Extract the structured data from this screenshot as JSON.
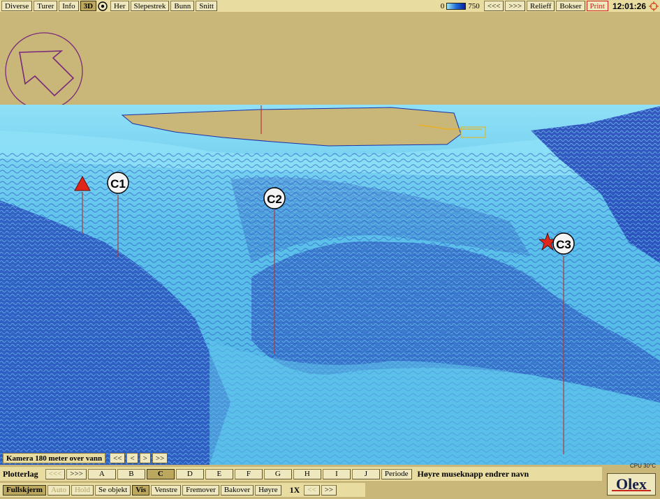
{
  "top_bar": {
    "buttons": [
      {
        "label": "Diverse"
      },
      {
        "label": "Turer"
      },
      {
        "label": "Info"
      },
      {
        "label": "3D",
        "active": true
      }
    ],
    "buttons_after_icon": [
      {
        "label": "Her"
      },
      {
        "label": "Slepestrek"
      },
      {
        "label": "Bunn"
      },
      {
        "label": "Snitt"
      }
    ],
    "depth_min": "0",
    "depth_max": "750",
    "right_buttons": [
      {
        "label": "<<<"
      },
      {
        "label": ">>>"
      },
      {
        "label": "Relieff"
      },
      {
        "label": "Bokser"
      },
      {
        "label": "Print"
      }
    ],
    "clock": "12:01:26"
  },
  "scene": {
    "markers": [
      {
        "label": "C1"
      },
      {
        "label": "C2"
      },
      {
        "label": "C3"
      }
    ],
    "symbols": [
      "triangle-marker-icon",
      "star-marker-icon",
      "compass-arrow-icon"
    ],
    "colors": {
      "sky": "#c9b679",
      "seabed_light": "#5fc6ec",
      "seabed_dark": "#1a2fa8",
      "marker_line": "#b13a35",
      "compass": "#7a2a7a"
    }
  },
  "camera_bar": {
    "label": "Kamera 180 meter over vann",
    "buttons": [
      "<<",
      "<",
      ">",
      ">>"
    ]
  },
  "plot_bar": {
    "title": "Plotterlag",
    "nav": [
      "<<<",
      ">>>"
    ],
    "letters": [
      "A",
      "B",
      "C",
      "D",
      "E",
      "F",
      "G",
      "H",
      "I",
      "J"
    ],
    "active_letter": "C",
    "period": "Periode",
    "hint": "Høyre museknapp endrer navn"
  },
  "view_bar": {
    "buttons": [
      "Fullskjerm",
      "Auto",
      "Hold",
      "Se objekt",
      "Vis",
      "Venstre",
      "Fremover",
      "Bakover",
      "Høyre"
    ],
    "speed": "1X",
    "speed_nav": [
      "<<",
      ">>"
    ]
  },
  "cpu": "CPU 30°C",
  "logo": "Olex"
}
